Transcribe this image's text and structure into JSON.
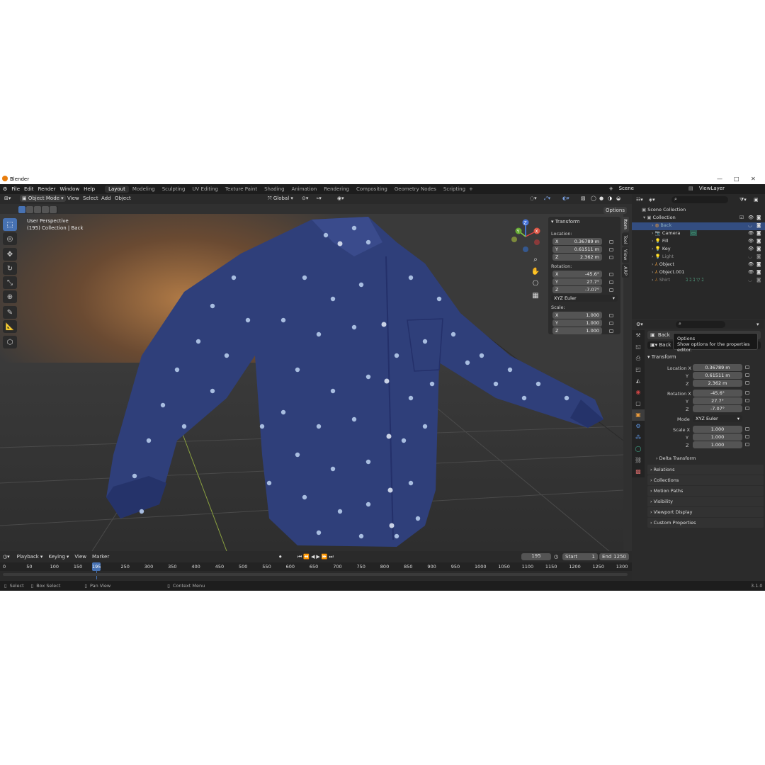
{
  "window_title": "Blender",
  "menus": [
    "File",
    "Edit",
    "Render",
    "Window",
    "Help"
  ],
  "workspaces": [
    "Layout",
    "Modeling",
    "Sculpting",
    "UV Editing",
    "Texture Paint",
    "Shading",
    "Animation",
    "Rendering",
    "Compositing",
    "Geometry Nodes",
    "Scripting"
  ],
  "active_workspace": "Layout",
  "scene": "Scene",
  "view_layer": "ViewLayer",
  "viewport_header": {
    "mode": "Object Mode",
    "view": "View",
    "select": "Select",
    "add": "Add",
    "object": "Object",
    "orientation": "Global",
    "options": "Options"
  },
  "viewport": {
    "perspective": "User Perspective",
    "collection_info": "(195) Collection | Back"
  },
  "npanel": {
    "title": "Transform",
    "location_label": "Location:",
    "location": [
      {
        "axis": "X",
        "value": "0.36789 m"
      },
      {
        "axis": "Y",
        "value": "0.61511 m"
      },
      {
        "axis": "Z",
        "value": "2.362 m"
      }
    ],
    "rotation_label": "Rotation:",
    "rotation": [
      {
        "axis": "X",
        "value": "-45.6°"
      },
      {
        "axis": "Y",
        "value": "27.7°"
      },
      {
        "axis": "Z",
        "value": "-7.07°"
      }
    ],
    "rotation_mode": "XYZ Euler",
    "scale_label": "Scale:",
    "scale": [
      {
        "axis": "X",
        "value": "1.000"
      },
      {
        "axis": "Y",
        "value": "1.000"
      },
      {
        "axis": "Z",
        "value": "1.000"
      }
    ],
    "tabs": [
      "Item",
      "Tool",
      "View",
      "ARP"
    ]
  },
  "outliner": {
    "root": "Scene Collection",
    "collection": "Collection",
    "items": [
      "Back",
      "Camera",
      "Fill",
      "Key",
      "Light",
      "Object",
      "Object.001",
      "Shirt"
    ]
  },
  "properties": {
    "object_name": "Back",
    "data_name": "Back",
    "tooltip_title": "Options",
    "tooltip_text": "Show options for the properties editor.",
    "transform_header": "Transform",
    "location_x_label": "Location X",
    "location": [
      "0.36789 m",
      "0.61511 m",
      "2.362 m"
    ],
    "rotation_x_label": "Rotation X",
    "rotation": [
      "-45.6°",
      "27.7°",
      "-7.07°"
    ],
    "mode_label": "Mode",
    "mode": "XYZ Euler",
    "scale_x_label": "Scale X",
    "scale": [
      "1.000",
      "1.000",
      "1.000"
    ],
    "y_label": "Y",
    "z_label": "Z",
    "sections": [
      "Delta Transform",
      "Relations",
      "Collections",
      "Motion Paths",
      "Visibility",
      "Viewport Display",
      "Custom Properties"
    ]
  },
  "timeline": {
    "menus": [
      "Playback",
      "Keying",
      "View",
      "Marker"
    ],
    "current_frame": "195",
    "start_label": "Start",
    "start": "1",
    "end_label": "End",
    "end": "1250",
    "ticks": [
      "0",
      "50",
      "100",
      "150",
      "195",
      "250",
      "300",
      "350",
      "400",
      "450",
      "500",
      "550",
      "600",
      "650",
      "700",
      "750",
      "800",
      "850",
      "900",
      "950",
      "1000",
      "1050",
      "1100",
      "1150",
      "1200",
      "1250",
      "1300"
    ]
  },
  "status": {
    "select": "Select",
    "box_select": "Box Select",
    "pan_view": "Pan View",
    "context_menu": "Context Menu",
    "version": "3.1.0"
  },
  "colors": {
    "accent": "#4772b3",
    "shirt": "#2f3f7a",
    "dot": "#a8bde0",
    "selected_row": "#334d80"
  }
}
